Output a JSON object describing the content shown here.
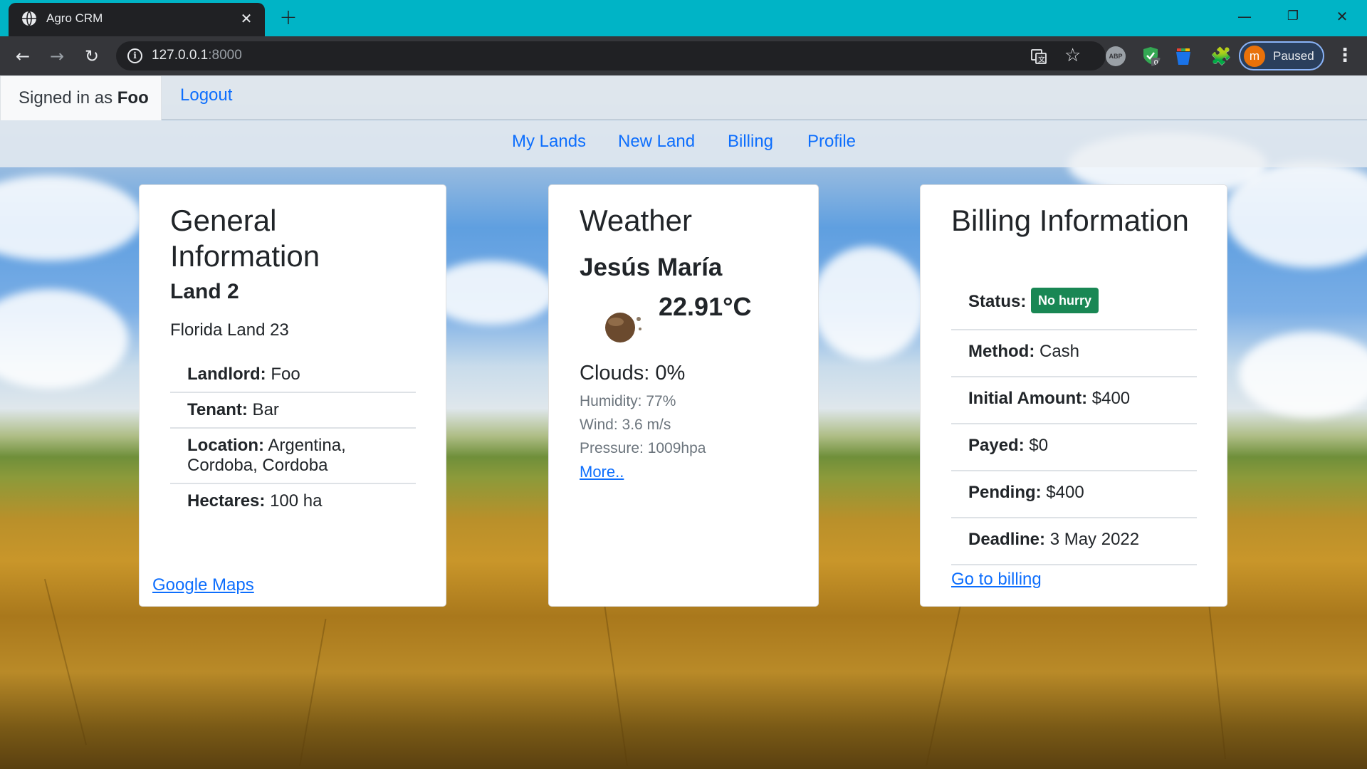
{
  "browser": {
    "tab_title": "Agro CRM",
    "url_host": "127.0.0.1",
    "url_port": ":8000",
    "profile_initial": "m",
    "profile_status": "Paused",
    "abp_label": "ABP",
    "extension_badge": "0"
  },
  "topbar": {
    "signed_in_prefix": "Signed in as ",
    "username": "Foo",
    "logout": "Logout"
  },
  "nav": {
    "my_lands": "My Lands",
    "new_land": "New Land",
    "billing": "Billing",
    "profile": "Profile"
  },
  "general": {
    "heading": "General Information",
    "land_name": "Land 2",
    "land_description": "Florida Land 23",
    "rows": [
      {
        "label": "Landlord:",
        "value": " Foo"
      },
      {
        "label": "Tenant:",
        "value": " Bar"
      },
      {
        "label": "Location:",
        "value": " Argentina, Cordoba, Cordoba"
      },
      {
        "label": "Hectares:",
        "value": " 100 ha"
      }
    ],
    "maps_link": "Google Maps"
  },
  "weather": {
    "heading": "Weather",
    "city": "Jesús María",
    "temperature": "22.91°C",
    "clouds": "Clouds: 0%",
    "humidity": "Humidity: 77%",
    "wind": "Wind: 3.6 m/s",
    "pressure": "Pressure: 1009hpa",
    "more_link": "More.."
  },
  "billing": {
    "heading": "Billing Information",
    "status_label": "Status:",
    "status_badge": "No hurry",
    "status_color": "#198754",
    "rows": [
      {
        "label": "Method:",
        "value": " Cash"
      },
      {
        "label": "Initial Amount:",
        "value": " $400"
      },
      {
        "label": "Payed:",
        "value": " $0"
      },
      {
        "label": "Pending:",
        "value": " $400"
      },
      {
        "label": "Deadline:",
        "value": " 3 May 2022"
      }
    ],
    "billing_link": "Go to billing"
  },
  "colors": {
    "link": "#0d6efd",
    "tabbar": "#00b4c6",
    "toolbar": "#35363a"
  }
}
